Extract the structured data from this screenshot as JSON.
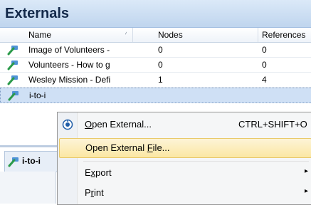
{
  "panel": {
    "title": "Externals"
  },
  "columns": [
    {
      "label": "Name",
      "sort_glyph": "⁄"
    },
    {
      "label": "Nodes"
    },
    {
      "label": "References"
    }
  ],
  "rows": [
    {
      "name": "Image of Volunteers -",
      "nodes": "0",
      "references": "0"
    },
    {
      "name": "Volunteers - How to g",
      "nodes": "0",
      "references": "0"
    },
    {
      "name": "Wesley Mission - Defi",
      "nodes": "1",
      "references": "4"
    },
    {
      "name": "i-to-i",
      "nodes": "",
      "references": ""
    }
  ],
  "lower_tab": {
    "label": "i-to-i"
  },
  "context_menu": {
    "items": [
      {
        "label_pre": "",
        "label_u": "O",
        "label_post": "pen External...",
        "shortcut": "CTRL+SHIFT+O",
        "icon": "open-external-icon"
      },
      {
        "label_pre": "Open External ",
        "label_u": "F",
        "label_post": "ile...",
        "shortcut": "",
        "highlighted": true
      },
      {
        "label_pre": "E",
        "label_u": "x",
        "label_post": "port",
        "submenu": "▸"
      },
      {
        "label_pre": "P",
        "label_u": "r",
        "label_post": "int",
        "submenu": "▸"
      }
    ]
  },
  "colors": {
    "accent": "#13294a",
    "selection": "#cfe0f5",
    "highlight": "#fbe7a3"
  }
}
